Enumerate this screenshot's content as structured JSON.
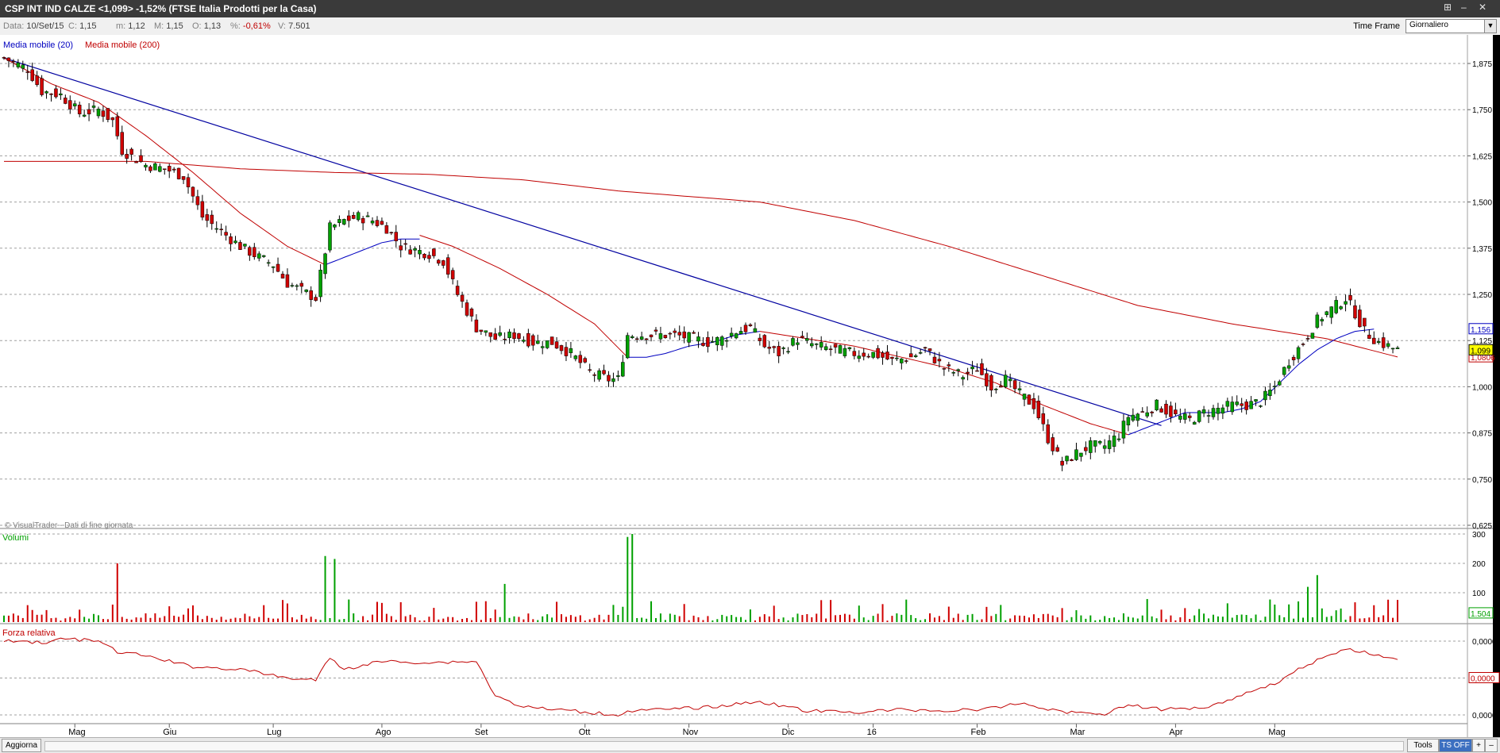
{
  "window": {
    "title": "CSP INT IND CALZE <1,099> -1,52% (FTSE Italia Prodotti per la Casa)",
    "controls": [
      "⊞",
      "–",
      "✕"
    ]
  },
  "info": {
    "data_label": "Data:",
    "data_value": "10/Set/15",
    "c_label": "C:",
    "c_value": "1,15",
    "m_label": "m:",
    "m_value": "1,12",
    "M_label": "M:",
    "M_value": "1,15",
    "o_label": "O:",
    "o_value": "1,13",
    "pct_label": "%:",
    "pct_value": "-0,61%",
    "v_label": "V:",
    "v_value": "7.501",
    "timeframe_label": "Time Frame",
    "timeframe_value": "Giornaliero"
  },
  "legend": {
    "ma20": "Media mobile (20)",
    "ma200": "Media mobile (200)",
    "watermark": "© VisualTrader - Dati di fine giornata",
    "volume_title": "Volumi",
    "rs_title": "Forza relativa"
  },
  "bottom": {
    "refresh": "Aggiorna",
    "tools": "Tools",
    "ts_off": "TS OFF",
    "plus": "+",
    "minus": "–"
  },
  "colors": {
    "up": "#00a000",
    "down": "#d00000",
    "ma20": "#0000c0",
    "ma200": "#c00000",
    "trendline": "#0000a0",
    "current_value_bg": "#ffff00"
  },
  "chart_data": [
    {
      "type": "candlestick",
      "title": "CSP INT IND CALZE",
      "x_ticks": [
        "Mag",
        "Giu",
        "Lug",
        "Ago",
        "Set",
        "Ott",
        "Nov",
        "Dic",
        "16",
        "Feb",
        "Mar",
        "Apr",
        "Mag"
      ],
      "y_ticks": [
        "1,875",
        "1,750",
        "1,625",
        "1,500",
        "1,375",
        "1,250",
        "1,125",
        "1,000",
        "0,875",
        "0,750",
        "0,625"
      ],
      "ylim": [
        0.625,
        1.875
      ],
      "grid": true,
      "series": [
        {
          "name": "Media mobile (20)"
        },
        {
          "name": "Media mobile (200)"
        }
      ],
      "last_values": {
        "ma20": "1,156",
        "close": "1,099",
        "ma200": "1,0806"
      },
      "close_anchors": [
        [
          0,
          1.89
        ],
        [
          5,
          1.86
        ],
        [
          8,
          1.8
        ],
        [
          12,
          1.79
        ],
        [
          16,
          1.74
        ],
        [
          20,
          1.75
        ],
        [
          23,
          1.72
        ],
        [
          25,
          1.64
        ],
        [
          30,
          1.6
        ],
        [
          34,
          1.59
        ],
        [
          38,
          1.57
        ],
        [
          42,
          1.46
        ],
        [
          46,
          1.42
        ],
        [
          50,
          1.38
        ],
        [
          54,
          1.35
        ],
        [
          57,
          1.33
        ],
        [
          60,
          1.28
        ],
        [
          63,
          1.26
        ],
        [
          66,
          1.24
        ],
        [
          69,
          1.43
        ],
        [
          72,
          1.45
        ],
        [
          75,
          1.46
        ],
        [
          78,
          1.45
        ],
        [
          81,
          1.43
        ],
        [
          84,
          1.38
        ],
        [
          87,
          1.37
        ],
        [
          90,
          1.36
        ],
        [
          93,
          1.34
        ],
        [
          96,
          1.25
        ],
        [
          100,
          1.16
        ],
        [
          104,
          1.13
        ],
        [
          108,
          1.14
        ],
        [
          112,
          1.12
        ],
        [
          116,
          1.12
        ],
        [
          120,
          1.09
        ],
        [
          124,
          1.04
        ],
        [
          128,
          1.02
        ],
        [
          130,
          1.02
        ],
        [
          132,
          1.14
        ],
        [
          135,
          1.14
        ],
        [
          138,
          1.14
        ],
        [
          142,
          1.14
        ],
        [
          146,
          1.13
        ],
        [
          149,
          1.12
        ],
        [
          152,
          1.13
        ],
        [
          155,
          1.15
        ],
        [
          158,
          1.16
        ],
        [
          161,
          1.11
        ],
        [
          164,
          1.09
        ],
        [
          168,
          1.13
        ],
        [
          172,
          1.11
        ],
        [
          176,
          1.1
        ],
        [
          180,
          1.09
        ],
        [
          184,
          1.09
        ],
        [
          188,
          1.07
        ],
        [
          192,
          1.08
        ],
        [
          195,
          1.1
        ],
        [
          199,
          1.05
        ],
        [
          203,
          1.03
        ],
        [
          206,
          1.05
        ],
        [
          209,
          1.0
        ],
        [
          212,
          1.02
        ],
        [
          215,
          0.98
        ],
        [
          218,
          0.95
        ],
        [
          221,
          0.86
        ],
        [
          224,
          0.79
        ],
        [
          227,
          0.82
        ],
        [
          230,
          0.84
        ],
        [
          233,
          0.84
        ],
        [
          236,
          0.87
        ],
        [
          238,
          0.92
        ],
        [
          241,
          0.93
        ],
        [
          244,
          0.95
        ],
        [
          248,
          0.92
        ],
        [
          251,
          0.91
        ],
        [
          254,
          0.93
        ],
        [
          257,
          0.94
        ],
        [
          260,
          0.95
        ],
        [
          263,
          0.95
        ],
        [
          266,
          0.96
        ],
        [
          269,
          1.0
        ],
        [
          272,
          1.07
        ],
        [
          275,
          1.12
        ],
        [
          278,
          1.18
        ],
        [
          281,
          1.21
        ],
        [
          284,
          1.24
        ],
        [
          286,
          1.2
        ],
        [
          288,
          1.15
        ],
        [
          291,
          1.12
        ],
        [
          293,
          1.11
        ],
        [
          295,
          1.099
        ]
      ],
      "ma20_anchors": [
        [
          68,
          1.33
        ],
        [
          72,
          1.35
        ],
        [
          76,
          1.37
        ],
        [
          80,
          1.39
        ],
        [
          84,
          1.4
        ],
        [
          88,
          1.4
        ],
        [
          132,
          1.08
        ],
        [
          136,
          1.08
        ],
        [
          140,
          1.09
        ],
        [
          145,
          1.11
        ],
        [
          150,
          1.12
        ],
        [
          155,
          1.14
        ],
        [
          160,
          1.15
        ],
        [
          238,
          0.87
        ],
        [
          242,
          0.89
        ],
        [
          246,
          0.91
        ],
        [
          250,
          0.93
        ],
        [
          254,
          0.93
        ],
        [
          258,
          0.93
        ],
        [
          262,
          0.94
        ],
        [
          266,
          0.96
        ],
        [
          270,
          1.01
        ],
        [
          274,
          1.06
        ],
        [
          278,
          1.1
        ],
        [
          282,
          1.13
        ],
        [
          286,
          1.15
        ],
        [
          290,
          1.156
        ]
      ],
      "ma200_anchors": [
        [
          0,
          1.61
        ],
        [
          30,
          1.61
        ],
        [
          50,
          1.59
        ],
        [
          70,
          1.58
        ],
        [
          90,
          1.575
        ],
        [
          110,
          1.56
        ],
        [
          130,
          1.53
        ],
        [
          160,
          1.5
        ],
        [
          180,
          1.45
        ],
        [
          200,
          1.38
        ],
        [
          220,
          1.3
        ],
        [
          240,
          1.22
        ],
        [
          260,
          1.17
        ],
        [
          280,
          1.13
        ],
        [
          295,
          1.0806
        ]
      ],
      "ma20_early_anchors": [
        [
          0,
          1.89
        ],
        [
          10,
          1.82
        ],
        [
          20,
          1.77
        ],
        [
          30,
          1.68
        ],
        [
          40,
          1.58
        ],
        [
          50,
          1.47
        ],
        [
          60,
          1.38
        ],
        [
          68,
          1.33
        ]
      ],
      "ma20_mid_anchors": [
        [
          88,
          1.41
        ],
        [
          95,
          1.38
        ],
        [
          105,
          1.32
        ],
        [
          115,
          1.25
        ],
        [
          125,
          1.17
        ],
        [
          132,
          1.08
        ]
      ],
      "ma20_late_anchors": [
        [
          160,
          1.15
        ],
        [
          170,
          1.13
        ],
        [
          180,
          1.11
        ],
        [
          190,
          1.08
        ],
        [
          200,
          1.05
        ],
        [
          210,
          1.01
        ],
        [
          220,
          0.95
        ],
        [
          230,
          0.9
        ],
        [
          238,
          0.87
        ]
      ],
      "trendline": {
        "from": [
          0,
          1.89
        ],
        "to": [
          245,
          0.895
        ]
      }
    },
    {
      "type": "bar",
      "title": "Volumi",
      "y_ticks": [
        "300",
        "200",
        "100"
      ],
      "ylim": [
        0,
        300
      ],
      "last_value": "1.504",
      "spikes": [
        [
          24,
          200
        ],
        [
          68,
          225
        ],
        [
          70,
          215
        ],
        [
          106,
          130
        ],
        [
          132,
          290
        ],
        [
          133,
          300
        ],
        [
          278,
          160
        ],
        [
          276,
          120
        ]
      ]
    },
    {
      "type": "line",
      "title": "Forza relativa",
      "y_ticks": [
        "0,0000",
        "0,0000"
      ],
      "last_value": "0,0000",
      "anchors": [
        [
          0,
          -0.2
        ],
        [
          10,
          -0.18
        ],
        [
          12,
          -0.24
        ],
        [
          20,
          -0.2
        ],
        [
          24,
          -0.04
        ],
        [
          30,
          0.02
        ],
        [
          40,
          0.18
        ],
        [
          50,
          0.22
        ],
        [
          60,
          0.35
        ],
        [
          66,
          0.38
        ],
        [
          69,
          0.05
        ],
        [
          72,
          0.22
        ],
        [
          80,
          0.1
        ],
        [
          90,
          0.12
        ],
        [
          100,
          0.1
        ],
        [
          104,
          0.62
        ],
        [
          110,
          0.78
        ],
        [
          120,
          0.84
        ],
        [
          130,
          0.9
        ],
        [
          132,
          0.84
        ],
        [
          140,
          0.82
        ],
        [
          150,
          0.78
        ],
        [
          160,
          0.7
        ],
        [
          170,
          0.84
        ],
        [
          180,
          0.86
        ],
        [
          190,
          0.82
        ],
        [
          200,
          0.84
        ],
        [
          210,
          0.8
        ],
        [
          215,
          0.72
        ],
        [
          220,
          0.8
        ],
        [
          225,
          0.86
        ],
        [
          233,
          0.88
        ],
        [
          238,
          0.75
        ],
        [
          245,
          0.82
        ],
        [
          255,
          0.78
        ],
        [
          262,
          0.6
        ],
        [
          270,
          0.4
        ],
        [
          275,
          0.18
        ],
        [
          280,
          0.02
        ],
        [
          285,
          -0.08
        ],
        [
          290,
          0.0
        ],
        [
          295,
          0.08
        ]
      ]
    }
  ]
}
